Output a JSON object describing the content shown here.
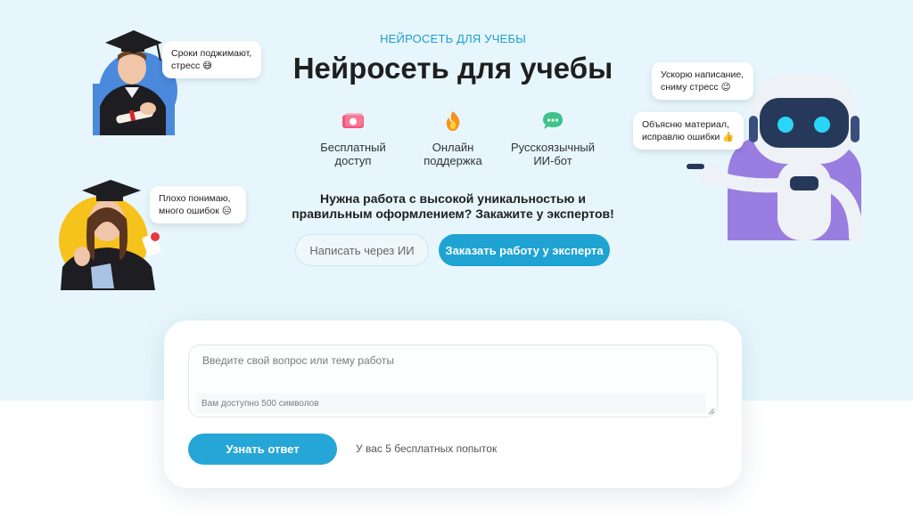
{
  "hero": {
    "kicker": "НЕЙРОСЕТЬ ДЛЯ УЧЕБЫ",
    "title": "Нейросеть для учебы",
    "features": [
      {
        "icon": "money-icon",
        "line1": "Бесплатный",
        "line2": "доступ"
      },
      {
        "icon": "fire-icon",
        "line1": "Онлайн",
        "line2": "поддержка"
      },
      {
        "icon": "chat-icon",
        "line1": "Русскоязычный",
        "line2": "ИИ-бот"
      }
    ],
    "cta_line1": "Нужна работа с высокой уникальностью и",
    "cta_line2": "правильным оформлением? Закажите у экспертов!",
    "btn_ai": "Написать через ИИ",
    "btn_expert": "Заказать работу у эксперта"
  },
  "bubbles": {
    "student_top_1": "Сроки поджимают,",
    "student_top_2": "стресс 😅",
    "student_bottom_1": "Плохо понимаю,",
    "student_bottom_2": "много ошибок 😑",
    "robot_1_1": "Ускорю написание,",
    "robot_1_2": "сниму стресс 😉",
    "robot_2_1": "Объясню материал,",
    "robot_2_2": "исправлю ошибки 👍"
  },
  "form": {
    "placeholder": "Введите свой вопрос или тему работы",
    "counter": "Вам доступно 500 символов",
    "submit": "Узнать ответ",
    "attempts": "У вас 5 бесплатных попыток"
  },
  "colors": {
    "hero_bg": "#e6f6fc",
    "accent": "#1ea3d3",
    "kicker": "#1b9fd0"
  }
}
